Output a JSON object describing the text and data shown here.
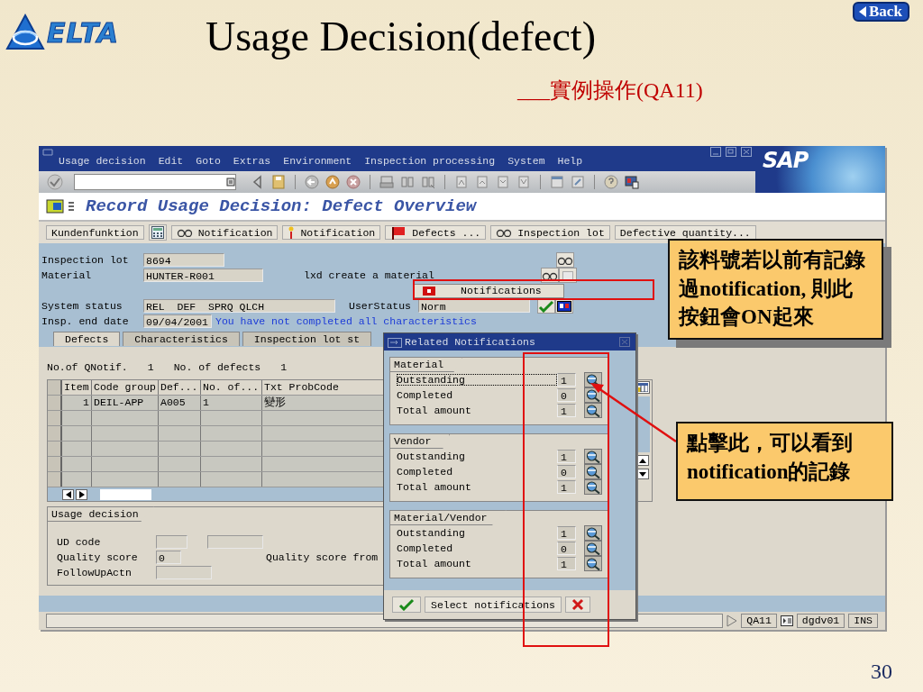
{
  "slide": {
    "logo": "ELTA",
    "title": "Usage Decision(defect)",
    "subtitle": "___實例操作(QA11)",
    "back_button": "Back",
    "page_number": "30"
  },
  "window": {
    "sap_logo": "SAP",
    "menu": [
      "Usage decision",
      "Edit",
      "Goto",
      "Extras",
      "Environment",
      "Inspection processing",
      "System",
      "Help"
    ],
    "screen_title": "Record Usage Decision: Defect Overview",
    "app_toolbar": [
      "Kundenfunktion",
      "Notification",
      "Notification",
      "Defects ...",
      "Inspection lot",
      "Defective quantity..."
    ],
    "header": {
      "inspection_lot_label": "Inspection lot",
      "inspection_lot": "8694",
      "material_label": "Material",
      "material": "HUNTER-R001",
      "material_text": "lxd create a material",
      "notifications_button": "Notifications",
      "system_status_label": "System status",
      "system_status": "REL  DEF  SPRQ QLCH",
      "user_status_label": "UserStatus",
      "user_status": "Norm",
      "end_date_label": "Insp. end date",
      "end_date": "09/04/2001",
      "message": "You have not completed all characteristics"
    },
    "tabs": [
      {
        "label": "Defects",
        "selected": true
      },
      {
        "label": "Characteristics",
        "selected": false
      },
      {
        "label": "Inspection lot st",
        "selected": false
      }
    ],
    "counts": {
      "qnotif_label": "No.of QNotif.",
      "qnotif": "1",
      "defects_label": "No. of defects",
      "defects": "1"
    },
    "table": {
      "columns": [
        "Item",
        "Code group",
        "Def...",
        "No. of...",
        "Txt ProbCode"
      ],
      "rows": [
        [
          "1",
          "DEIL-APP",
          "A005",
          "1",
          "變形"
        ]
      ]
    },
    "usage_decision": {
      "title": "Usage decision",
      "ud_code_label": "UD code",
      "quality_score_label": "Quality score",
      "quality_score": "0",
      "followup_label": "FollowUpActn",
      "score_from_label": "Quality score from"
    },
    "status_bar": {
      "transaction": "QA11",
      "server": "dgdv01",
      "mode": "INS"
    }
  },
  "popup": {
    "title": "Related Notifications",
    "groups": [
      {
        "title": "Material",
        "rows": [
          {
            "label": "Outstanding",
            "value": "1",
            "focused": true
          },
          {
            "label": "Completed",
            "value": "0",
            "focused": false
          },
          {
            "label": "Total amount",
            "value": "1",
            "focused": false
          }
        ]
      },
      {
        "title": "Vendor",
        "rows": [
          {
            "label": "Outstanding",
            "value": "1",
            "focused": false
          },
          {
            "label": "Completed",
            "value": "0",
            "focused": false
          },
          {
            "label": "Total amount",
            "value": "1",
            "focused": false
          }
        ]
      },
      {
        "title": "Material/Vendor",
        "rows": [
          {
            "label": "Outstanding",
            "value": "1",
            "focused": false
          },
          {
            "label": "Completed",
            "value": "0",
            "focused": false
          },
          {
            "label": "Total amount",
            "value": "1",
            "focused": false
          }
        ]
      }
    ],
    "button": "Select notifications"
  },
  "callouts": [
    {
      "text": "該料號若以前有記錄過notification, 則此按鈕會ON起來",
      "shadow": true
    },
    {
      "text": "點擊此，可以看到notification的記錄",
      "shadow": false
    }
  ]
}
